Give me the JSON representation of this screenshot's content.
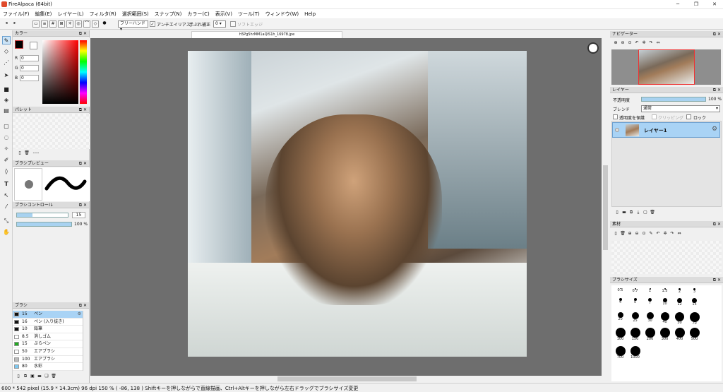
{
  "window": {
    "title": "FireAlpaca (64bit)",
    "min": "─",
    "max": "❐",
    "close": "✕"
  },
  "menu": [
    "ファイル(F)",
    "編集(E)",
    "レイヤー(L)",
    "フィルタ(R)",
    "選択範囲(S)",
    "スナップ(N)",
    "カラー(C)",
    "表示(V)",
    "ツール(T)",
    "ウィンドウ(W)",
    "Help"
  ],
  "toolbar": {
    "brush_mode": "フリーハンド",
    "antialias": "アンチエイリアス",
    "stabilizer_label": "手ぶれ補正",
    "stabilizer_value": "0",
    "soft_edge": "ソフトエッジ"
  },
  "document": {
    "tab": "h5Pg5hrMM1aQIS1h_16978.jpe"
  },
  "status": "600 * 542 pixel   (15.9 * 14.3cm)   96 dpi   150 %   ( -86, 138 )   Shiftキーを押しながらで直線描画、Ctrl+Altキーを押しながら左右ドラッグでブラシサイズ変更",
  "panels": {
    "color": {
      "title": "カラー",
      "r_label": "R",
      "g_label": "G",
      "b_label": "B",
      "r": "0",
      "g": "0",
      "b": "0"
    },
    "palette": {
      "title": "パレット",
      "dots": "----"
    },
    "brush_preview": {
      "title": "ブラシプレビュー"
    },
    "brush_control": {
      "title": "ブラシコントロール",
      "size": "15",
      "opacity": "100 %",
      "size_fill": 0.3,
      "opacity_fill": 1.0
    },
    "brush": {
      "title": "ブラシ",
      "items": [
        {
          "size": "15",
          "name": "ペン",
          "color": "#111111"
        },
        {
          "size": "16",
          "name": "ペン (入り抜き)",
          "color": "#111111"
        },
        {
          "size": "10",
          "name": "鉛筆",
          "color": "#111111"
        },
        {
          "size": "8.5",
          "name": "消しゴム",
          "color": "#ffffff"
        },
        {
          "size": "15",
          "name": "ぶらペン",
          "color": "#22aa22"
        },
        {
          "size": "50",
          "name": "エアブラシ",
          "color": "#ffffff"
        },
        {
          "size": "100",
          "name": "エアブラシ",
          "color": "#bbbbbb"
        },
        {
          "size": "80",
          "name": "水彩",
          "color": "#7ec8f0"
        }
      ]
    },
    "navigator": {
      "title": "ナビゲーター"
    },
    "layer": {
      "title": "レイヤー",
      "opacity_label": "不透明度",
      "opacity_value": "100 %",
      "blend_label": "ブレンド",
      "blend_value": "通常",
      "protect_alpha": "透明度を保護",
      "clipping": "クリッピング",
      "lock": "ロック",
      "layer_name": "レイヤー1"
    },
    "material": {
      "title": "素材"
    },
    "brush_size": {
      "title": "ブラシサイズ",
      "sizes": [
        "0.5",
        "0.7",
        "1",
        "1.5",
        "2",
        "3",
        "4",
        "5",
        "7",
        "10",
        "12",
        "15",
        "20",
        "25",
        "30",
        "40",
        "50",
        "70",
        "100",
        "150",
        "200",
        "300",
        "400",
        "500",
        "700",
        "1000"
      ]
    }
  }
}
